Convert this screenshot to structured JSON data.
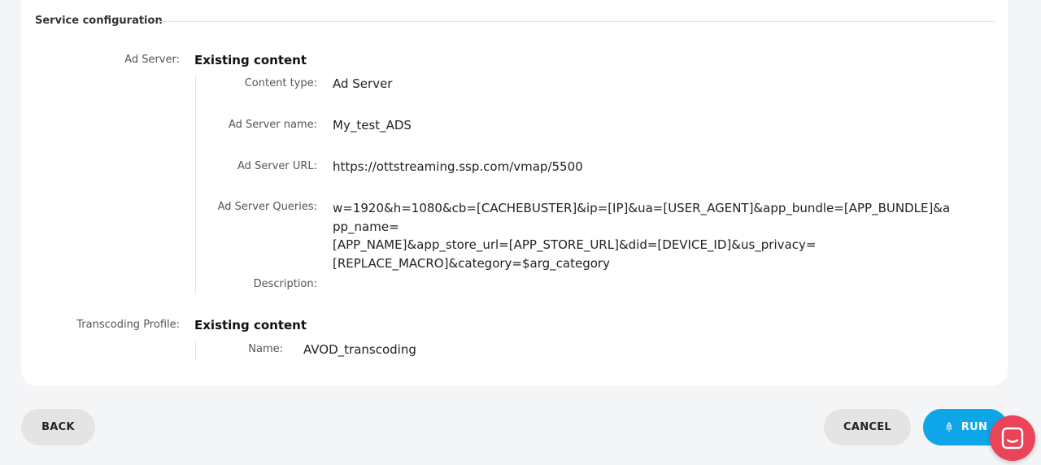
{
  "section": {
    "title": "Service configuration"
  },
  "ad_server": {
    "label": "Ad Server:",
    "value": "Existing content",
    "fields": {
      "content_type": {
        "label": "Content type:",
        "value": "Ad Server"
      },
      "name": {
        "label": "Ad Server name:",
        "value": "My_test_ADS"
      },
      "url": {
        "label": "Ad Server URL:",
        "value": "https://ottstreaming.ssp.com/vmap/5500"
      },
      "queries": {
        "label": "Ad Server Queries:",
        "lines": [
          "w=1920&h=1080&cb=[CACHEBUSTER]&ip=[IP]&ua=[USER_AGENT]&app_bundle=[APP_BUNDLE]&app_name=",
          "[APP_NAME]&app_store_url=[APP_STORE_URL]&did=[DEVICE_ID]&us_privacy=",
          "[REPLACE_MACRO]&category=$arg_category"
        ]
      },
      "description": {
        "label": "Description:",
        "value": ""
      }
    }
  },
  "transcoding": {
    "label": "Transcoding Profile:",
    "value": "Existing content",
    "fields": {
      "name": {
        "label": "Name:",
        "value": "AVOD_transcoding"
      }
    }
  },
  "footer": {
    "back_label": "BACK",
    "cancel_label": "CANCEL",
    "run_label": "RUN"
  },
  "colors": {
    "run_button": "#0ea5e9",
    "chat_bubble": "#ea4459",
    "grey_button": "#e4e4e4"
  },
  "icons": {
    "run": "rocket-icon",
    "chat": "chat-icon"
  }
}
